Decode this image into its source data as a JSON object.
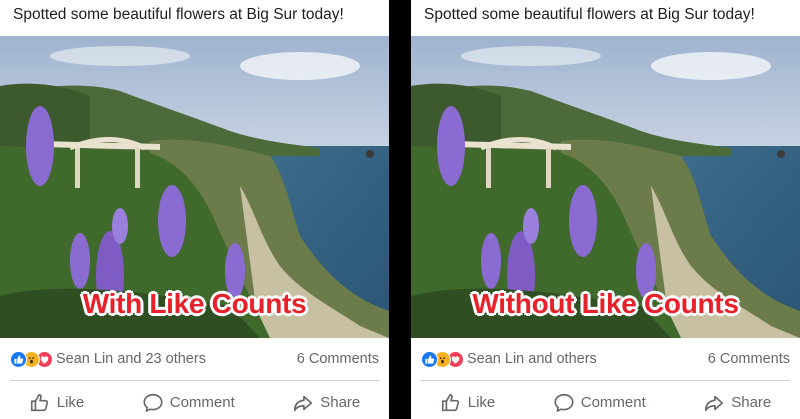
{
  "panels": [
    {
      "post_text": "Spotted some beautiful flowers at Big Sur today!",
      "overlay_label": "With Like Counts",
      "reactors_text": "Sean Lin and 23 others",
      "comments_count": "6 Comments",
      "actions": {
        "like": "Like",
        "comment": "Comment",
        "share": "Share"
      }
    },
    {
      "post_text": "Spotted some beautiful flowers at Big Sur today!",
      "overlay_label": "Without Like Counts",
      "reactors_text": "Sean Lin and others",
      "comments_count": "6 Comments",
      "actions": {
        "like": "Like",
        "comment": "Comment",
        "share": "Share"
      }
    }
  ],
  "reaction_icons": [
    "like-reaction-icon",
    "wow-reaction-icon",
    "love-reaction-icon"
  ],
  "colors": {
    "overlay_label": "#e8202a",
    "like_blue": "#1877f2",
    "wow_yellow": "#f7b125",
    "love_red": "#f33e58",
    "secondary_text": "#65676b"
  }
}
